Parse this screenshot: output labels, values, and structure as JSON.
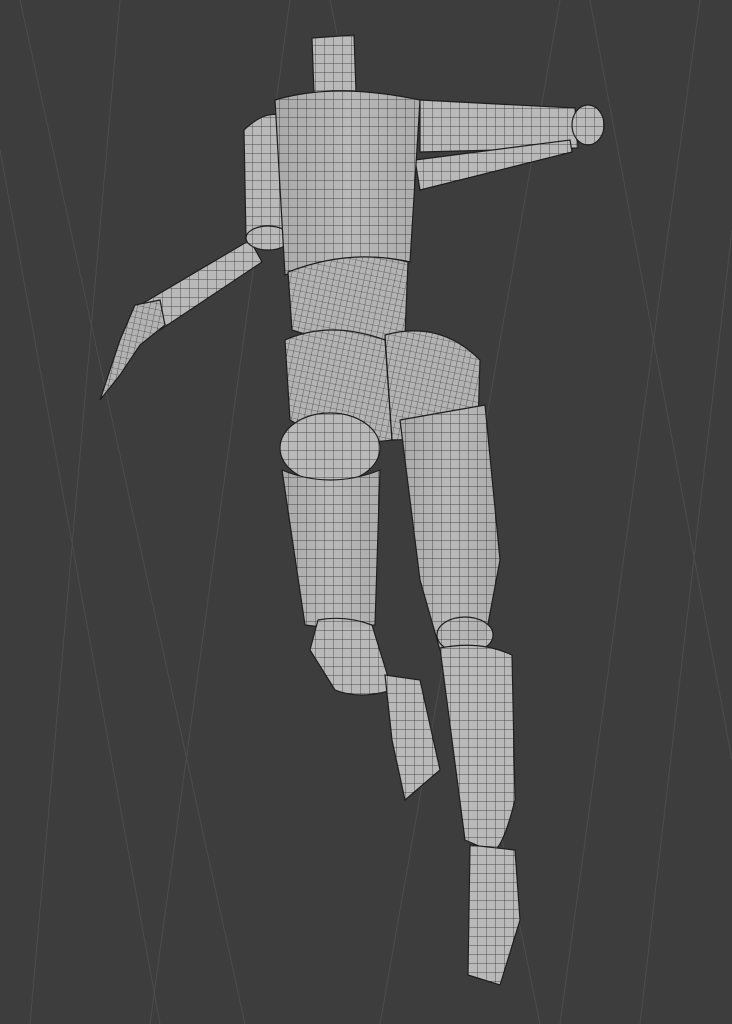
{
  "viewport": {
    "background_color": "#3d3d3d",
    "grid_line_color": "#4c4c4c",
    "mesh_fill_color": "#b9b9b9",
    "mesh_shadow_color": "#8c8c8c",
    "wire_color": "#1e1e1e",
    "object": "wireframe-humanoid-mesh"
  }
}
